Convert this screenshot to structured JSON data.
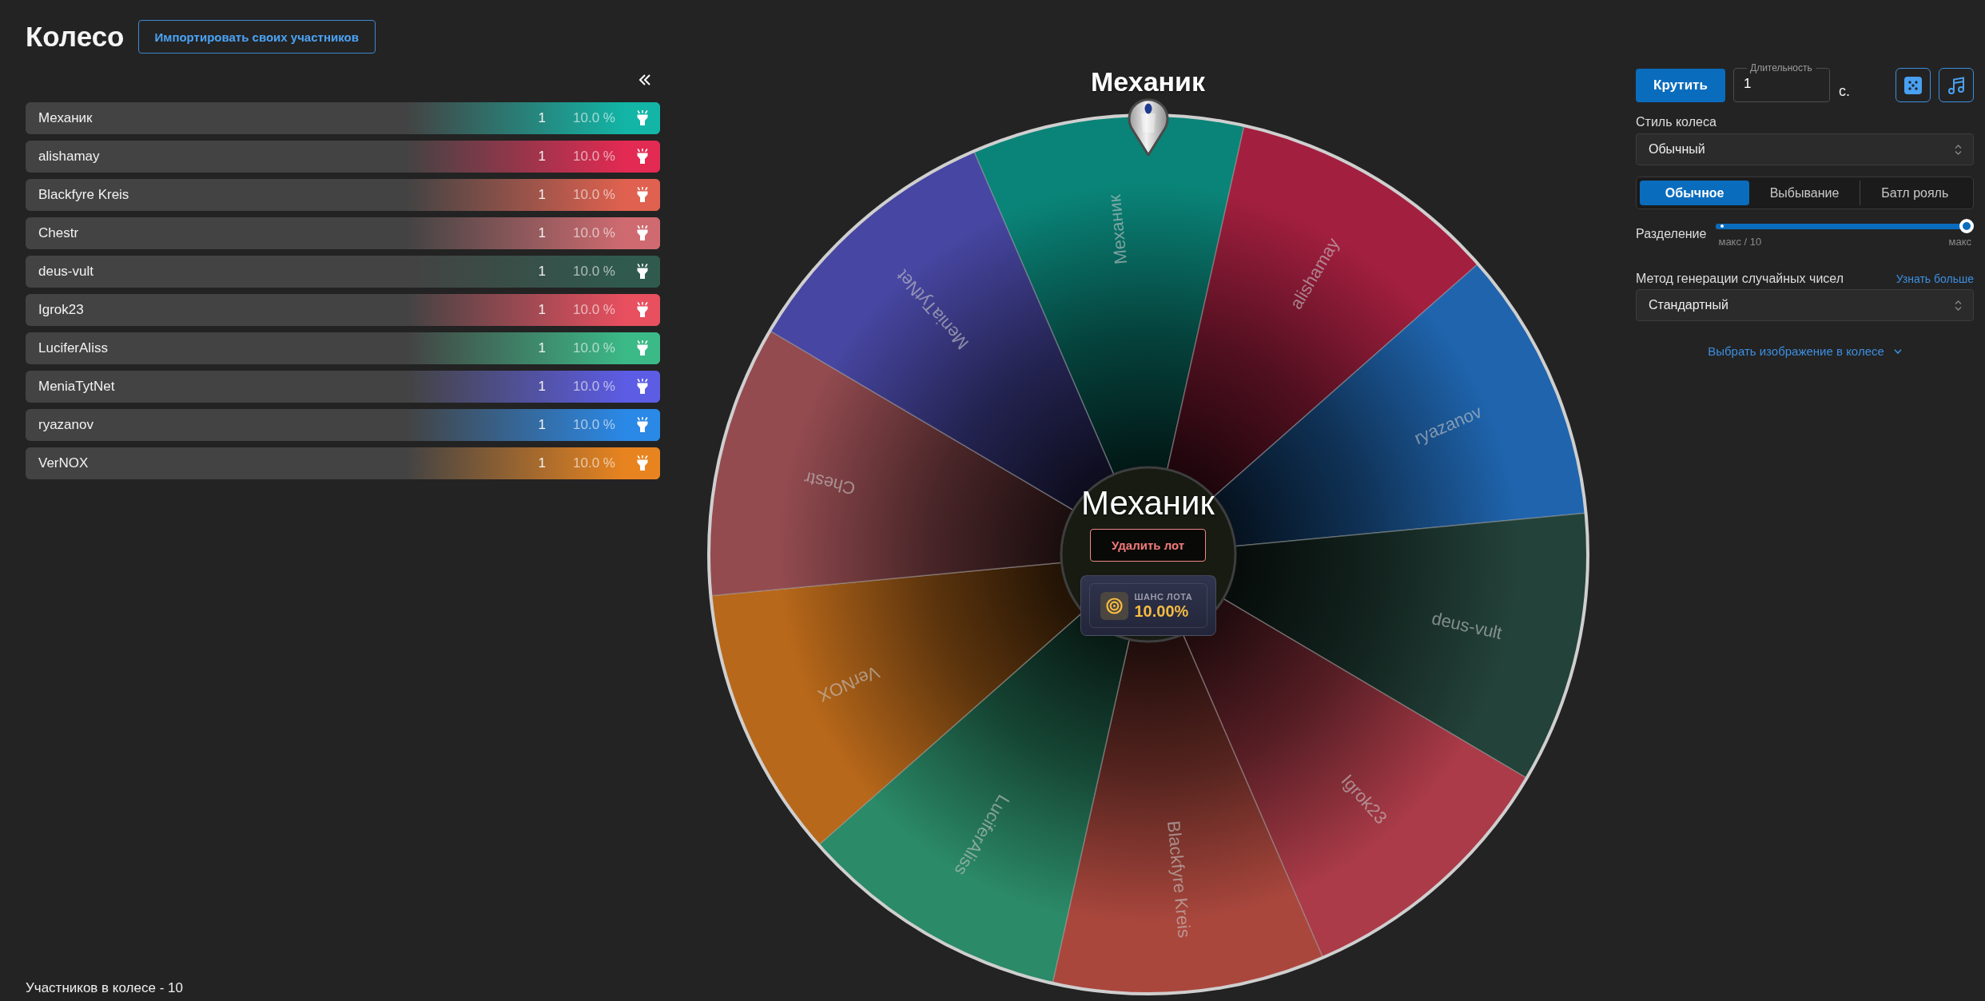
{
  "header": {
    "title": "Колесо",
    "import_button": "Импортировать своих участников"
  },
  "participants": [
    {
      "name": "Механик",
      "count": "1",
      "share": "10.0 %",
      "color": "#12b5a6"
    },
    {
      "name": "alishamay",
      "count": "1",
      "share": "10.0 %",
      "color": "#e22a52"
    },
    {
      "name": "Blackfyre Kreis",
      "count": "1",
      "share": "10.0 %",
      "color": "#e0614f"
    },
    {
      "name": "Chestr",
      "count": "1",
      "share": "10.0 %",
      "color": "#cf6b70"
    },
    {
      "name": "deus-vult",
      "count": "1",
      "share": "10.0 %",
      "color": "#2f5a4d"
    },
    {
      "name": "Igrok23",
      "count": "1",
      "share": "10.0 %",
      "color": "#e84f5f"
    },
    {
      "name": "LuciferAliss",
      "count": "1",
      "share": "10.0 %",
      "color": "#3bb987"
    },
    {
      "name": "MeniaTytNet",
      "count": "1",
      "share": "10.0 %",
      "color": "#5c5ce4"
    },
    {
      "name": "ryazanov",
      "count": "1",
      "share": "10.0 %",
      "color": "#2a88e6"
    },
    {
      "name": "VerNOX",
      "count": "1",
      "share": "10.0 %",
      "color": "#e8841f"
    }
  ],
  "participants_total": "Участников в колесе - 10",
  "wheel": {
    "winner_title": "Механик",
    "segments": [
      {
        "label": "Механик",
        "color": "#0a8478"
      },
      {
        "label": "alishamay",
        "color": "#a31f3f"
      },
      {
        "label": "ryazanov",
        "color": "#1f64ad"
      },
      {
        "label": "deus-vult",
        "color": "#234239"
      },
      {
        "label": "Igrok23",
        "color": "#ab3b48"
      },
      {
        "label": "Blackfyre Kreis",
        "color": "#aa473d"
      },
      {
        "label": "LuciferAliss",
        "color": "#2b8a68"
      },
      {
        "label": "VerNOX",
        "color": "#b8681a"
      },
      {
        "label": "Chestr",
        "color": "#934b50"
      },
      {
        "label": "MeniaTytNet",
        "color": "#4746a2"
      }
    ],
    "center": {
      "name": "Механик",
      "delete_button": "Удалить лот",
      "chance_label": "ШАНС ЛОТА",
      "chance_value": "10.00%"
    }
  },
  "controls": {
    "spin_button": "Крутить",
    "duration": {
      "label": "Длительность",
      "value": "1",
      "unit": "с."
    },
    "wheel_style": {
      "label": "Стиль колеса",
      "value": "Обычный"
    },
    "modes": [
      {
        "label": "Обычное",
        "selected": true
      },
      {
        "label": "Выбывание",
        "selected": false
      },
      {
        "label": "Батл рояль",
        "selected": false
      }
    ],
    "split": {
      "label": "Разделение",
      "level": 1,
      "min_label": "макс / 10",
      "max_label": "макс"
    },
    "rng": {
      "label": "Метод генерации случайных чисел",
      "link": "Узнать больше",
      "value": "Стандартный"
    },
    "image_link": "Выбрать изображение в колесе"
  }
}
